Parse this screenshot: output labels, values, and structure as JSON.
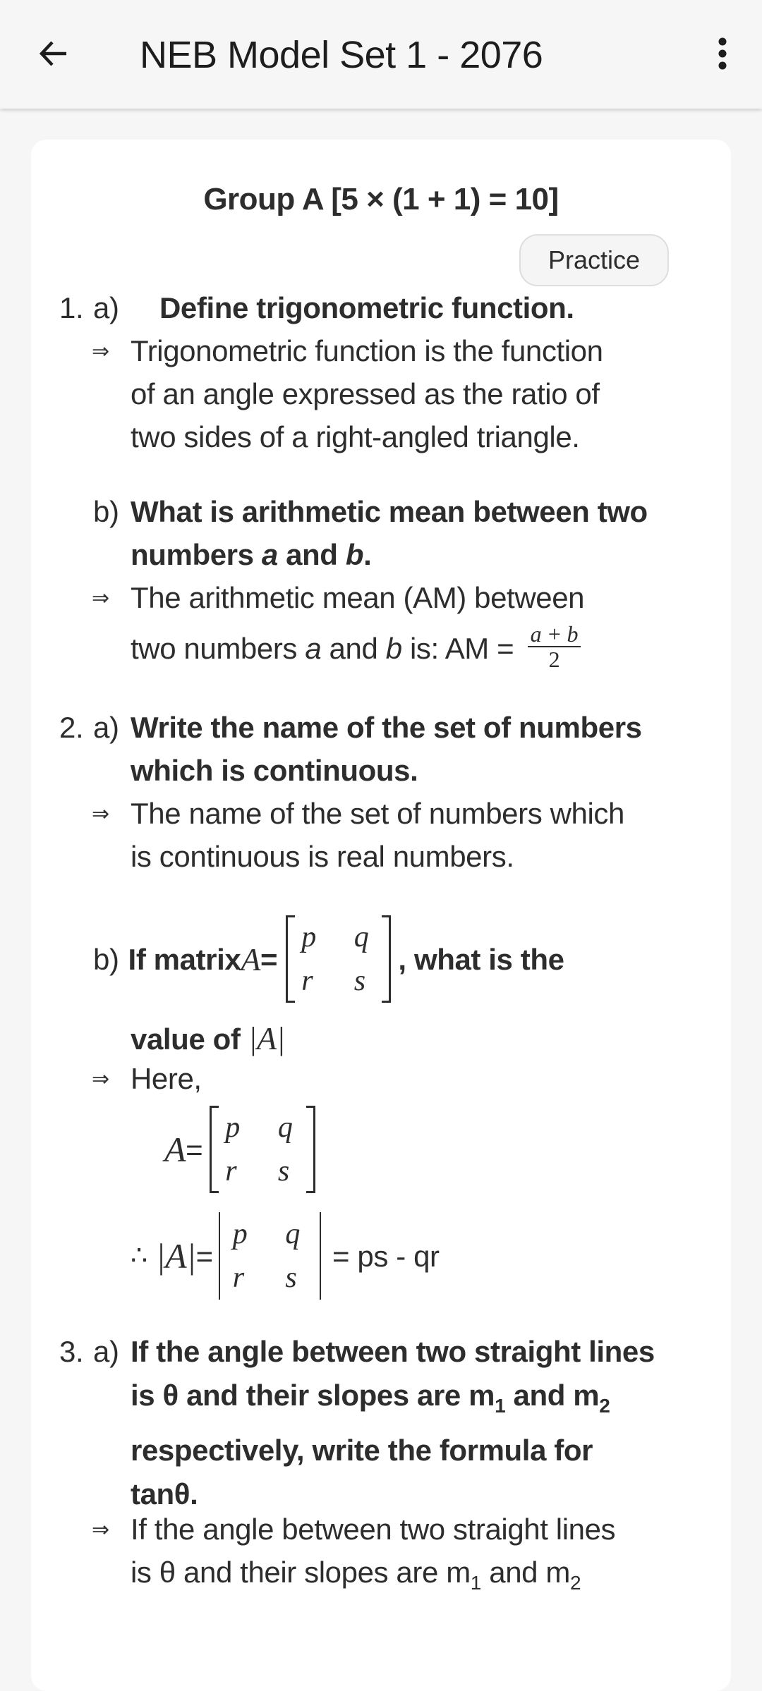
{
  "appbar": {
    "title": "NEB Model Set 1 - 2076",
    "back_icon": "arrow-left-icon",
    "menu_icon": "more-vert-icon"
  },
  "content": {
    "group_title": "Group A [5 × (1 + 1) = 10]",
    "practice_label": "Practice",
    "answer_marker": "⇒",
    "questions": [
      {
        "number": "1.",
        "label": "a)",
        "question": "Define trigonometric function.",
        "answer_lines": [
          "Trigonometric function is the function",
          "of an angle expressed as the ratio of",
          "two sides of a right-angled triangle."
        ]
      },
      {
        "number": "",
        "label": "b)",
        "question_line1": "What is arithmetic mean between two",
        "question_line2_pre": "numbers ",
        "question_var_a": "a",
        "question_and": " and ",
        "question_var_b": "b",
        "question_line2_post": ".",
        "answer_line1": "The arithmetic mean (AM) between",
        "answer_line2_pre": "two numbers ",
        "answer_var_a": "a",
        "answer_and": " and ",
        "answer_var_b": "b",
        "answer_line2_post": " is: AM = ",
        "fraction_numerator": "a + b",
        "fraction_denominator": "2"
      },
      {
        "number": "2.",
        "label": "a)",
        "question_lines": [
          "Write the name of the set of numbers",
          "which is continuous."
        ],
        "answer_lines": [
          "The name of the set of numbers which",
          "is continuous is real numbers."
        ]
      },
      {
        "number": "",
        "label": "b)",
        "question_pre": "If matrix ",
        "matrix_name": "A",
        "equals": " = ",
        "question_post": ", what is the",
        "question_line2": "value of ",
        "det_expr": "|A|",
        "matrix": [
          [
            "p",
            "q"
          ],
          [
            "r",
            "s"
          ]
        ],
        "answer_here": "Here,",
        "therefore": "∴",
        "result": "= ps - qr"
      },
      {
        "number": "3.",
        "label": "a)",
        "question_line1": "If the angle between two straight lines",
        "question_line2_pre": "is θ and their slopes are m",
        "sub1": "1",
        "question_line2_mid": " and m",
        "sub2": "2",
        "question_line3": "respectively, write the formula for",
        "question_line4": "tanθ.",
        "answer_line1": "If the angle between two straight lines",
        "answer_line2_pre": "is θ and their slopes are m",
        "answer_line2_mid": " and m"
      }
    ]
  }
}
